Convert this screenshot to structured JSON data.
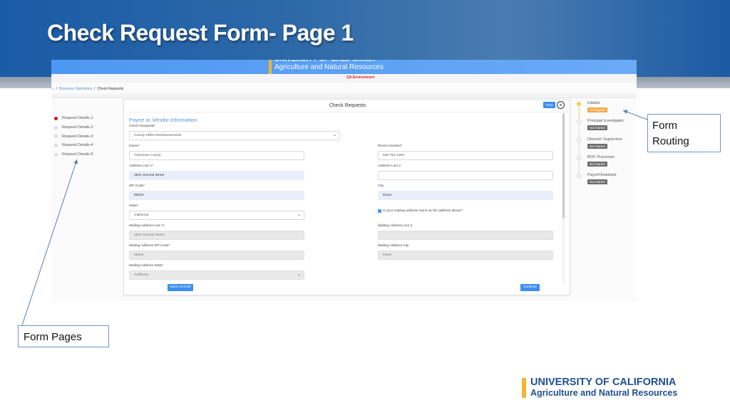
{
  "slide": {
    "title": "Check Request Form- Page 1",
    "callouts": {
      "routing": "Form Routing",
      "pages": "Form Pages"
    },
    "footer_logo": {
      "line1": "UNIVERSITY OF CALIFORNIA",
      "line2": "Agriculture and Natural Resources"
    }
  },
  "app": {
    "header_logo": {
      "line1": "UNIVERSITY OF CALIFORNIA",
      "line2": "Agriculture and Natural Resources"
    },
    "environment": "QA Environment",
    "breadcrumb": {
      "home_icon": "home-icon",
      "items": [
        "Business Operations",
        "Check Requests"
      ],
      "separator": "/"
    },
    "form_pages": [
      {
        "label": "Request Details-1",
        "active": true
      },
      {
        "label": "Request Details-2",
        "active": false
      },
      {
        "label": "Request Details-3",
        "active": false
      },
      {
        "label": "Request Details-4",
        "active": false
      },
      {
        "label": "Request Details-5",
        "active": false
      }
    ],
    "card": {
      "title": "Check Requests",
      "print_label": "Print",
      "close_icon": "close-circle-icon",
      "section_title": "Payee or Vendor Information",
      "fields": {
        "check_requests": {
          "label": "Check Requests*",
          "value": "County Office Reimbursements"
        },
        "name": {
          "label": "Name*",
          "value": "Tuolumne County"
        },
        "phone": {
          "label": "Phone Number*",
          "value": "530-752-1290"
        },
        "address1": {
          "label": "Address Line 1*",
          "value": "2801 Second Street"
        },
        "address2": {
          "label": "Address Line 2",
          "value": ""
        },
        "zip": {
          "label": "ZIP Code*",
          "value": "95618"
        },
        "city": {
          "label": "City",
          "value": "Davis"
        },
        "state": {
          "label": "State*",
          "value": "California"
        },
        "same_address": {
          "label": "Is your mailing address same as the address above?",
          "checked": true
        },
        "mail_address1": {
          "label": "Mailing Address Line 1*",
          "value": "2801 Second Street"
        },
        "mail_address2": {
          "label": "Mailing Address Line 2",
          "value": ""
        },
        "mail_zip": {
          "label": "Mailing Address ZIP Code*",
          "value": "95618"
        },
        "mail_city": {
          "label": "Mailing Address City",
          "value": "Davis"
        },
        "mail_state": {
          "label": "Mailing Address State*",
          "value": "California"
        }
      },
      "save_draft_label": "Save As Draft",
      "continue_label": "Continue"
    },
    "routing": [
      {
        "role": "Initiator",
        "status": "In Progress",
        "active": true
      },
      {
        "role": "Principal Investigator",
        "status": "Not Started",
        "active": false
      },
      {
        "role": "Director/ Supervisor",
        "status": "Not Started",
        "active": false
      },
      {
        "role": "BOC Processor",
        "status": "Not Started",
        "active": false
      },
      {
        "role": "Payroll Assistant",
        "status": "Not Started",
        "active": false
      }
    ]
  },
  "colors": {
    "banner": "#1a5ba6",
    "app_header": "#4e97f2",
    "primary_button": "#3d8ef0",
    "active_step": "#d0101b",
    "in_progress": "#f5a94a",
    "not_started": "#6c6c6c",
    "logo_accent": "#f2b52f",
    "logo_text": "#1f4f8f",
    "qa_text": "#e02020"
  }
}
